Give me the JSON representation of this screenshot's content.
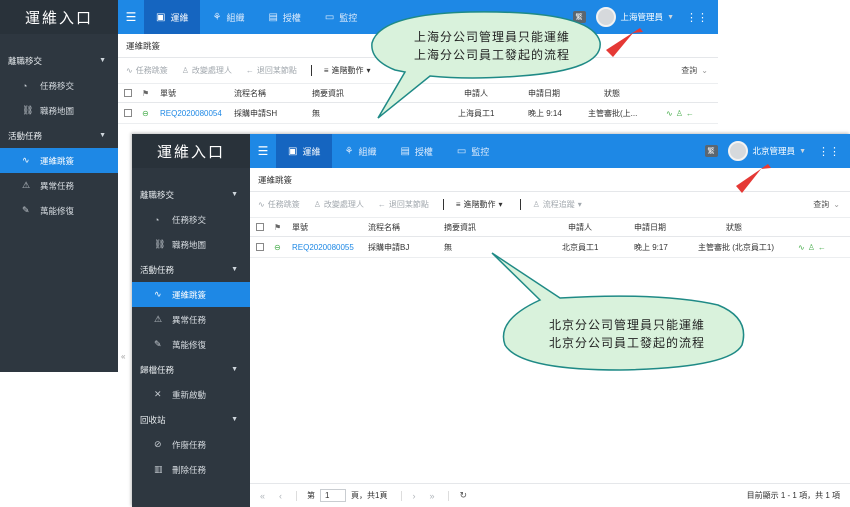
{
  "shanghai": {
    "logo": "運維入口",
    "nav": {
      "groups": [
        {
          "label": "離職移交",
          "items": [
            {
              "label": "任務移交",
              "icon": "gauge-icon"
            },
            {
              "label": "職務地圖",
              "icon": "org-chart-icon"
            }
          ]
        },
        {
          "label": "活動任務",
          "items": [
            {
              "label": "運維跳簽",
              "icon": "flow-icon",
              "active": true
            },
            {
              "label": "異常任務",
              "icon": "warning-icon"
            },
            {
              "label": "萬能修復",
              "icon": "wrench-icon"
            }
          ]
        }
      ]
    },
    "tabs": [
      "運維",
      "組織",
      "授權",
      "監控"
    ],
    "lang": "繁",
    "user": "上海管理員",
    "page_tab": "運維跳簽",
    "toolbar": [
      "任務跳簽",
      "改變處理人",
      "退回某節點",
      "進階動作"
    ],
    "search": "查詢",
    "columns": [
      "單號",
      "流程名稱",
      "摘要資訊",
      "申請人",
      "申請日期",
      "狀態"
    ],
    "rows": [
      {
        "id": "REQ2020080054",
        "process": "採購申請SH",
        "summary": "無",
        "applicant": "上海員工1",
        "date": "晚上 9:14",
        "status": "主管審批(上..."
      }
    ]
  },
  "beijing": {
    "logo": "運維入口",
    "nav": {
      "groups": [
        {
          "label": "離職移交",
          "items": [
            {
              "label": "任務移交",
              "icon": "gauge-icon"
            },
            {
              "label": "職務地圖",
              "icon": "org-chart-icon"
            }
          ]
        },
        {
          "label": "活動任務",
          "items": [
            {
              "label": "運維跳簽",
              "icon": "flow-icon",
              "active": true
            },
            {
              "label": "異常任務",
              "icon": "warning-icon"
            },
            {
              "label": "萬能修復",
              "icon": "wrench-icon"
            }
          ]
        },
        {
          "label": "歸檔任務",
          "items": [
            {
              "label": "重新啟動",
              "icon": "tools-icon"
            }
          ]
        },
        {
          "label": "回收站",
          "items": [
            {
              "label": "作廢任務",
              "icon": "ban-icon"
            },
            {
              "label": "刪除任務",
              "icon": "trash-icon"
            }
          ]
        }
      ]
    },
    "tabs": [
      "運維",
      "組織",
      "授權",
      "監控"
    ],
    "lang": "繁",
    "user": "北京管理員",
    "page_tab": "運維跳簽",
    "toolbar": [
      "任務跳簽",
      "改變處理人",
      "退回某節點",
      "進階動作",
      "流程追蹤"
    ],
    "search": "查詢",
    "columns": [
      "單號",
      "流程名稱",
      "摘要資訊",
      "申請人",
      "申請日期",
      "狀態"
    ],
    "rows": [
      {
        "id": "REQ2020080055",
        "process": "採購申請BJ",
        "summary": "無",
        "applicant": "北京員工1",
        "date": "晚上 9:17",
        "status": "主管審批 (北京員工1)"
      }
    ],
    "pager": {
      "page_label": "第",
      "page": "1",
      "total": "頁，共1頁",
      "info": "目前顯示 1 - 1 項，共 1 項"
    }
  },
  "callouts": {
    "shanghai": [
      "上海分公司管理員只能運維",
      "上海分公司員工發起的流程"
    ],
    "beijing": [
      "北京分公司管理員只能運維",
      "北京分公司員工發起的流程"
    ]
  },
  "colors": {
    "accent": "#1e88e5",
    "sidebar": "#2e3740",
    "callout_fill": "#d9f2dc",
    "callout_border": "#1f8a86",
    "arrow": "#e53935"
  }
}
